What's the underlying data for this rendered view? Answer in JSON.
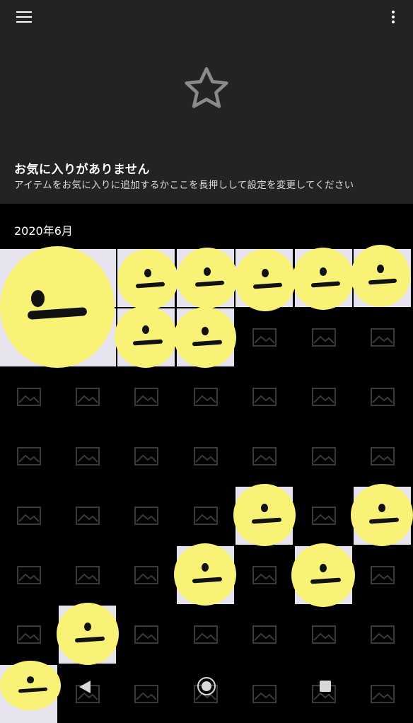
{
  "header": {
    "menu_icon": "hamburger-icon",
    "more_icon": "more-vert-icon"
  },
  "empty_state": {
    "icon": "star-outline-icon",
    "title": "お気に入りがありません",
    "subtitle": "アイテムをお気に入りに追加するかここを長押しして設定を変更してください"
  },
  "section": {
    "date_label": "2020年6月"
  },
  "colors": {
    "accent_placeholder": "#3a3a3a",
    "emoji": "#f8f277",
    "header_bg": "#232323"
  }
}
